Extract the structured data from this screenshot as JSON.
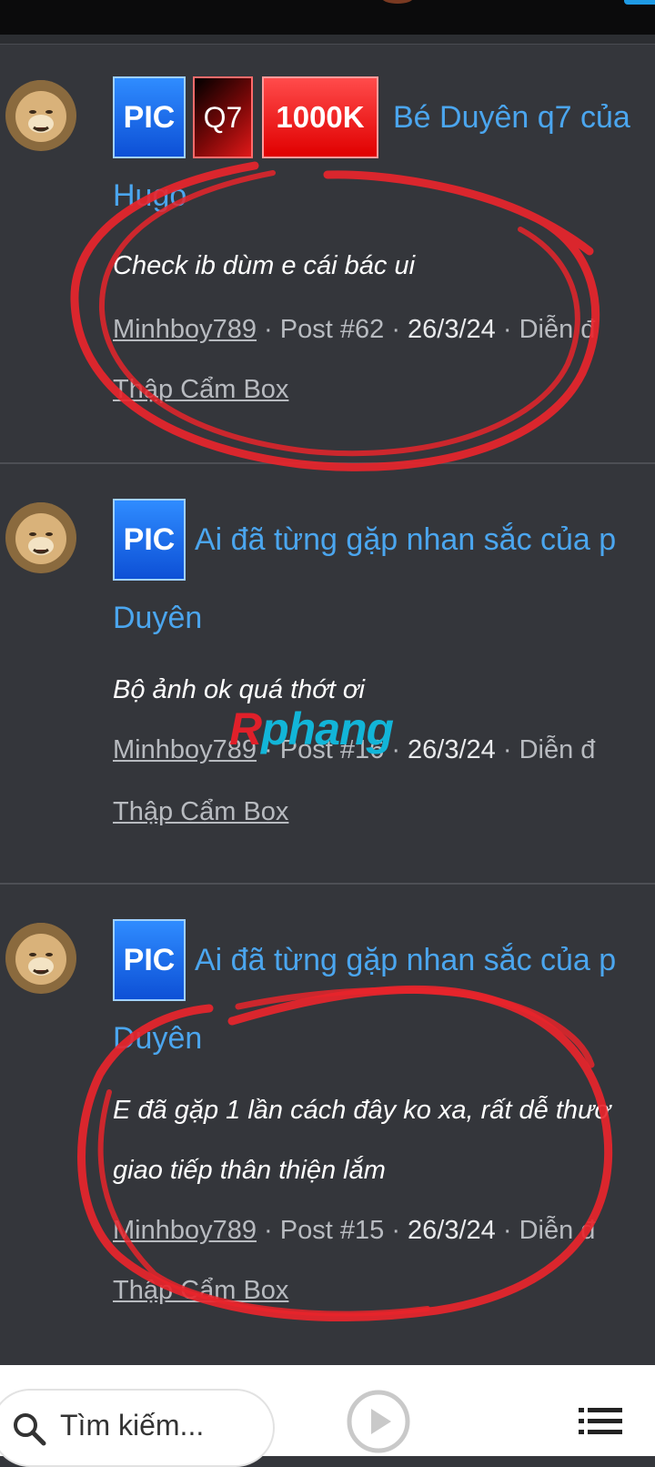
{
  "posts": [
    {
      "tags": [
        "PIC",
        "Q7",
        "1000K"
      ],
      "title_line1": "Bé Duyên q7 của",
      "title_line2": "Hugo",
      "body_lines": [
        "Check ib dùm e cái bác ui"
      ],
      "author": "Minhboy789",
      "post_no": "Post #62",
      "date": "26/3/24",
      "forum": "Diễn đ",
      "board": "Thập Cẩm Box"
    },
    {
      "tags": [
        "PIC"
      ],
      "title_line1": "Ai đã từng gặp nhan sắc của p",
      "title_line2": "Duyên",
      "body_lines": [
        "Bộ ảnh ok quá thớt ơi"
      ],
      "author": "Minhboy789",
      "post_no": "Post #16",
      "date": "26/3/24",
      "forum": "Diễn đ",
      "board": "Thập Cẩm Box"
    },
    {
      "tags": [
        "PIC"
      ],
      "title_line1": "Ai đã từng gặp nhan sắc của p",
      "title_line2": "Duyên",
      "body_lines": [
        "E đã gặp 1 lần cách đây ko xa, rất dễ thươ",
        "giao tiếp thân thiện lắm"
      ],
      "author": "Minhboy789",
      "post_no": "Post #15",
      "date": "26/3/24",
      "forum": "Diễn đ",
      "board": "Thập Cẩm Box"
    }
  ],
  "meta_separator": " · ",
  "watermark": {
    "part1": "R",
    "part2": "phang"
  },
  "bottom_bar": {
    "search_placeholder": "Tìm kiếm...",
    "search_icon": "search-icon",
    "play_icon": "play-icon",
    "menu_icon": "list-menu-icon"
  },
  "colors": {
    "background": "#34363b",
    "link": "#4ba6ef",
    "annotation": "#e8252c"
  }
}
